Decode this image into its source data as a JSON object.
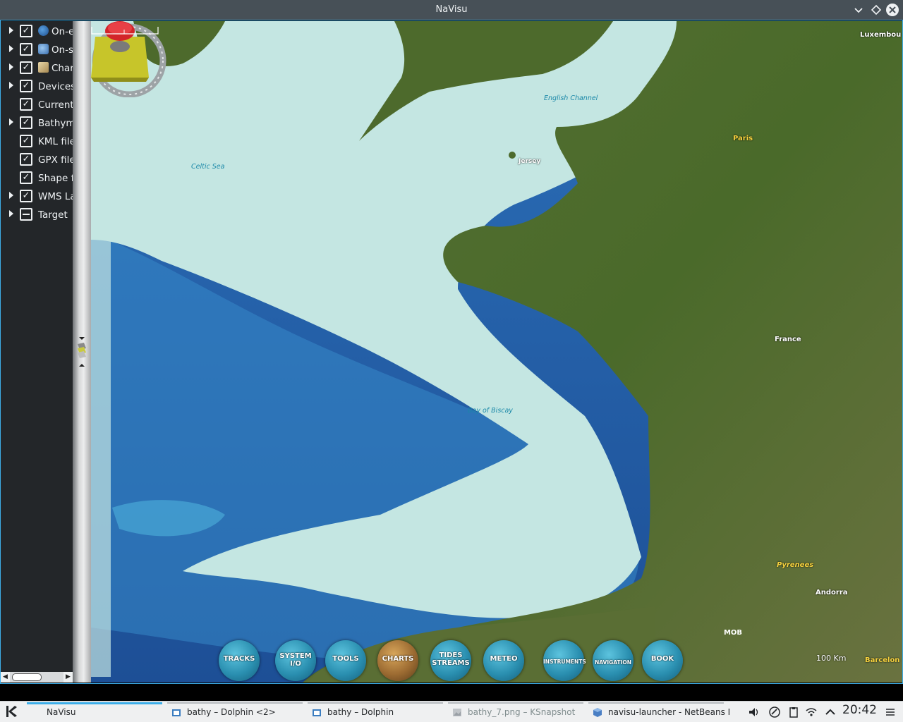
{
  "window": {
    "title": "NaVisu",
    "buttons": [
      "minimize",
      "restore",
      "close"
    ]
  },
  "layers": [
    {
      "label": "On-e",
      "expandable": true,
      "state": "checked",
      "icon": "earth-globe-icon"
    },
    {
      "label": "On-s",
      "expandable": true,
      "state": "checked",
      "icon": "globe-icon"
    },
    {
      "label": "Char",
      "expandable": true,
      "state": "checked",
      "icon": "chart-icon"
    },
    {
      "label": "Devices",
      "expandable": true,
      "state": "checked",
      "icon": ""
    },
    {
      "label": "Current",
      "expandable": false,
      "state": "checked",
      "icon": ""
    },
    {
      "label": "Bathym",
      "expandable": true,
      "state": "checked",
      "icon": ""
    },
    {
      "label": "KML file",
      "expandable": false,
      "state": "checked",
      "icon": ""
    },
    {
      "label": "GPX file",
      "expandable": false,
      "state": "checked",
      "icon": ""
    },
    {
      "label": "Shape f",
      "expandable": false,
      "state": "checked",
      "icon": ""
    },
    {
      "label": "WMS La",
      "expandable": true,
      "state": "checked",
      "icon": ""
    },
    {
      "label": "Target",
      "expandable": true,
      "state": "partial",
      "icon": ""
    }
  ],
  "map": {
    "labels": {
      "english_channel": "English Channel",
      "celtic_sea": "Celtic Sea",
      "jersey": "Jersey",
      "paris": "Paris",
      "luxembourg": "Luxembou",
      "france": "France",
      "bay_of_biscay": "Bay of Biscay",
      "pyrenees": "Pyrenees",
      "andorra": "Andorra",
      "barcelona": "Barcelon"
    },
    "scale_label": "100 Km",
    "colors": {
      "shelf": "#c4e6e2",
      "deep_ocean": "#2e6ab0",
      "land": "#4f6a2e",
      "compass_needle": "#d9232a"
    }
  },
  "toolbar": {
    "tracks": "TRACKS",
    "system_io_line1": "SYSTEM",
    "system_io_line2": "I/O",
    "tools": "TOOLS",
    "charts": "CHARTS",
    "tides_line1": "TIDES",
    "tides_line2": "STREAMS",
    "meteo": "METEO",
    "instruments": "INSTRUMENTS",
    "navigation": "NAVIGATION",
    "book": "BOOK",
    "mob": "MOB"
  },
  "taskbar": {
    "tasks": [
      {
        "label": "NaVisu",
        "active": true
      },
      {
        "label": "bathy – Dolphin <2>",
        "active": false
      },
      {
        "label": "bathy – Dolphin",
        "active": false
      },
      {
        "label": "bathy_7.png – KSnapshot",
        "active": false
      },
      {
        "label": "navisu-launcher - NetBeans I",
        "active": false
      }
    ],
    "clock": "20:42"
  }
}
